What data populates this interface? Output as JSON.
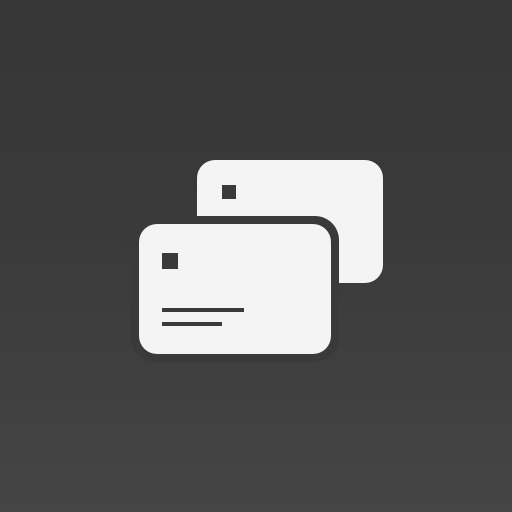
{
  "app_icon": {
    "icon_name": "cards-icon",
    "background_top_color": "#363636",
    "background_bottom_color": "#454545",
    "card_color": "#f4f4f4",
    "cutout_color": "#3a3a3a"
  }
}
